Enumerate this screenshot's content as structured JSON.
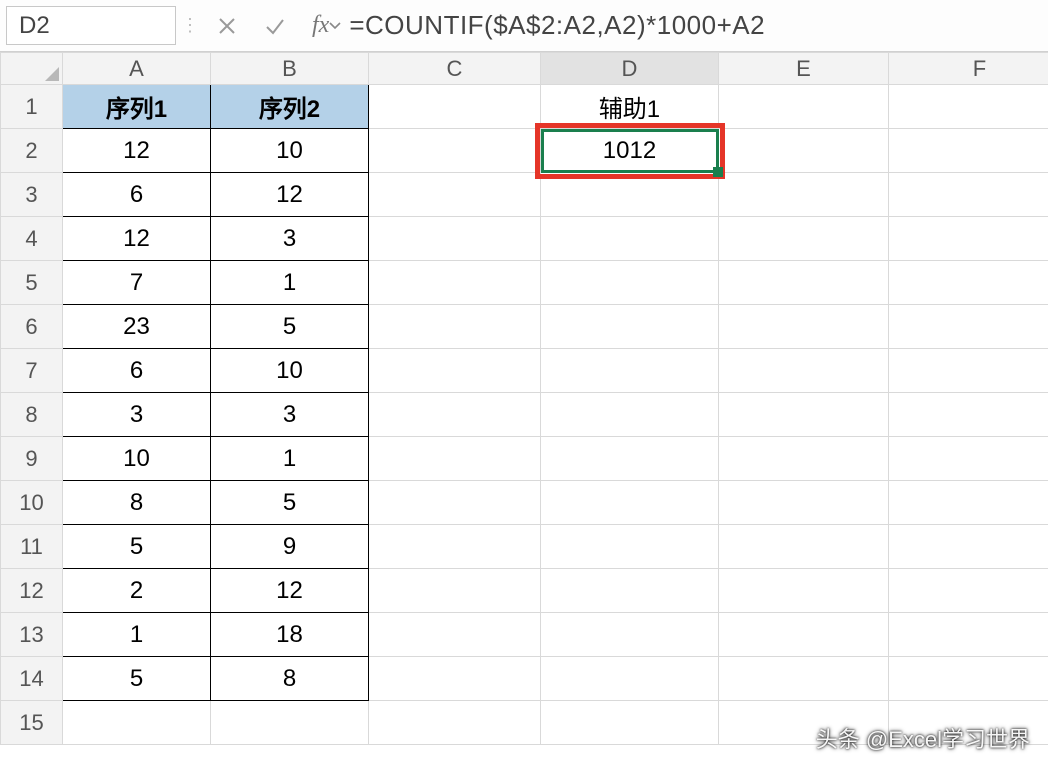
{
  "name_box": {
    "value": "D2"
  },
  "formula_bar": {
    "fx_label": "fx",
    "formula": "=COUNTIF($A$2:A2,A2)*1000+A2"
  },
  "columns": [
    "A",
    "B",
    "C",
    "D",
    "E",
    "F"
  ],
  "row_count": 15,
  "headers": {
    "A": "序列1",
    "B": "序列2",
    "D": "辅助1"
  },
  "table": {
    "A": [
      "12",
      "6",
      "12",
      "7",
      "23",
      "6",
      "3",
      "10",
      "8",
      "5",
      "2",
      "1",
      "5"
    ],
    "B": [
      "10",
      "12",
      "3",
      "1",
      "5",
      "10",
      "3",
      "1",
      "5",
      "9",
      "12",
      "18",
      "8"
    ]
  },
  "selected": {
    "cell": "D2",
    "value": "1012"
  },
  "watermark": "头条 @Excel学习世界",
  "icons": {
    "dropdown": "chevron-down-icon",
    "cancel": "cancel-icon",
    "enter": "check-icon",
    "fx": "fx-icon"
  }
}
